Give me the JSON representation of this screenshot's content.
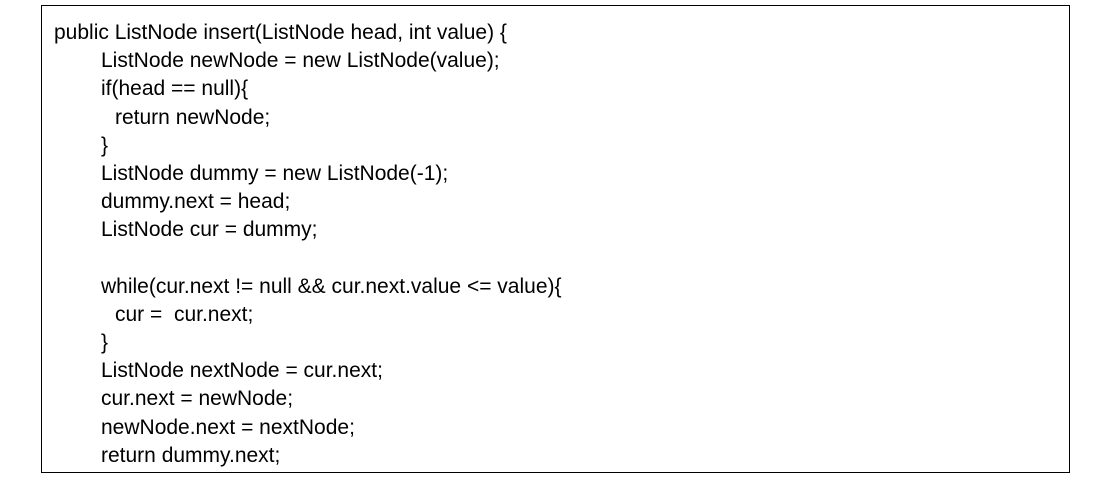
{
  "code": {
    "lines": [
      {
        "text": "public ListNode insert(ListNode head, int value) {",
        "indent": 0
      },
      {
        "text": "ListNode newNode = new ListNode(value);",
        "indent": 1
      },
      {
        "text": "if(head == null){",
        "indent": 1
      },
      {
        "text": "return newNode;",
        "indent": 2
      },
      {
        "text": "}",
        "indent": 1
      },
      {
        "text": "ListNode dummy = new ListNode(-1);",
        "indent": 1
      },
      {
        "text": "dummy.next = head;",
        "indent": 1
      },
      {
        "text": "ListNode cur = dummy;",
        "indent": 1
      },
      {
        "text": "",
        "indent": 1
      },
      {
        "text": "while(cur.next != null && cur.next.value <= value){",
        "indent": 1
      },
      {
        "text": "cur =  cur.next;",
        "indent": 2
      },
      {
        "text": "}",
        "indent": 1
      },
      {
        "text": "ListNode nextNode = cur.next;",
        "indent": 1
      },
      {
        "text": "cur.next = newNode;",
        "indent": 1
      },
      {
        "text": "newNode.next = nextNode;",
        "indent": 1
      },
      {
        "text": "return dummy.next;",
        "indent": 1
      }
    ]
  }
}
